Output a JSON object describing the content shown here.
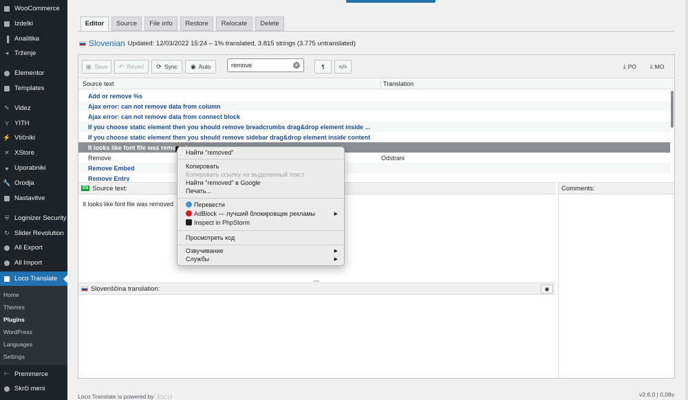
{
  "sidebar": {
    "items": [
      {
        "label": "WooCommerce",
        "icon": "woocommerce-icon"
      },
      {
        "label": "Izdelki",
        "icon": "products-icon"
      },
      {
        "label": "Analitika",
        "icon": "analytics-icon"
      },
      {
        "label": "Trženje",
        "icon": "marketing-icon"
      },
      {
        "label": "Elementor",
        "icon": "elementor-icon"
      },
      {
        "label": "Templates",
        "icon": "templates-icon"
      },
      {
        "label": "Videz",
        "icon": "appearance-icon"
      },
      {
        "label": "YITH",
        "icon": "yith-icon"
      },
      {
        "label": "Vtičniki",
        "icon": "plugins-icon"
      },
      {
        "label": "XStore",
        "icon": "xstore-icon"
      },
      {
        "label": "Uporabniki",
        "icon": "users-icon"
      },
      {
        "label": "Orodja",
        "icon": "tools-icon"
      },
      {
        "label": "Nastavitve",
        "icon": "settings-icon"
      },
      {
        "label": "Loginizer Security",
        "icon": "shield-icon"
      },
      {
        "label": "Slider Revolution",
        "icon": "slider-icon"
      },
      {
        "label": "All Export",
        "icon": "export-icon"
      },
      {
        "label": "All Import",
        "icon": "import-icon"
      },
      {
        "label": "Loco Translate",
        "icon": "loco-icon"
      }
    ],
    "submenu": [
      "Home",
      "Themes",
      "Plugins",
      "WordPress",
      "Languages",
      "Settings"
    ],
    "bottom": [
      {
        "label": "Premmerce",
        "icon": "premmerce-icon"
      },
      {
        "label": "Skrči meni",
        "icon": "collapse-icon"
      }
    ]
  },
  "tabs": [
    "Editor",
    "Source",
    "File info",
    "Restore",
    "Relocate",
    "Delete"
  ],
  "status": {
    "language": "Slovenian",
    "text": "Updated: 12/03/2022 15:24 – 1% translated, 3.815 strings (3.775 untranslated)"
  },
  "toolbar": {
    "save": "Save",
    "revert": "Revert",
    "sync": "Sync",
    "auto": "Auto",
    "search_value": "remove",
    "pilcrow": "¶",
    "code": "</>",
    "po": "PO",
    "mo": "MO"
  },
  "table": {
    "headers": [
      "Source text",
      "Translation"
    ],
    "rows": [
      {
        "source": "Add or remove %s",
        "translation": ""
      },
      {
        "source": "Ajax error: can not remove data from column",
        "translation": ""
      },
      {
        "source": "Ajax error: can not remove data from connect block",
        "translation": ""
      },
      {
        "source": "If you choose static element then you should remove breadcrumbs drag&drop element inside ...",
        "translation": ""
      },
      {
        "source": "If you choose static element then you should remove sidebar drag&drop element inside content",
        "translation": ""
      },
      {
        "source": "It looks like font file was removed",
        "translation": ""
      },
      {
        "source": "Remove",
        "translation": "Odstrani"
      },
      {
        "source": "Remove Embed",
        "translation": ""
      },
      {
        "source": "Remove Entry",
        "translation": ""
      }
    ]
  },
  "source_pane": {
    "title": "Source text:",
    "badge": "EN",
    "text": "It looks like font file was removed"
  },
  "comments_pane": {
    "title": "Comments:"
  },
  "translation_pane": {
    "title": "Slovenščina translation:"
  },
  "context_menu": {
    "find": "Найти \"removed\"",
    "copy": "Копировать",
    "copy_link": "Копировать ссылку на выделенный текст",
    "google": "Найти \"removed\" в Google",
    "print": "Печать...",
    "translate": "Перевести",
    "adblock": "AdBlock — лучший блокировщик рекламы",
    "phpstorm": "Inspect in PhpStorm",
    "view_source": "Просмотреть код",
    "speech": "Озвучивание",
    "services": "Службы"
  },
  "footer": {
    "powered": "Loco Translate is powered by",
    "logo": "loco",
    "version": "v2.6.0 | 0,08s"
  },
  "colors": {
    "accent": "#2271b1",
    "sidebar_bg": "#1d2327",
    "untranslated": "#1d4f91"
  }
}
